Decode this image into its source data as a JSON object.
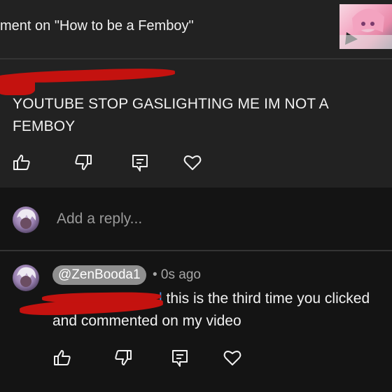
{
  "header": {
    "title": "ment on \"How to be a Femboy\""
  },
  "parent_comment": {
    "text": "YOUTUBE STOP GASLIGHTING ME IM NOT A FEMBOY"
  },
  "reply_box": {
    "placeholder": "Add a reply..."
  },
  "reply": {
    "handle": "@ZenBooda1",
    "timestamp": "• 0s ago",
    "mention_tail": "l",
    "text": " this is the third time you clicked and commented on my video"
  },
  "icons": {
    "like": "thumbs-up-icon",
    "dislike": "thumbs-down-icon",
    "reply": "reply-comment-icon",
    "heart": "heart-icon"
  },
  "colors": {
    "background": "#141414",
    "card": "#222222",
    "redaction": "#c4120f",
    "pill": "#8f8f8f"
  }
}
